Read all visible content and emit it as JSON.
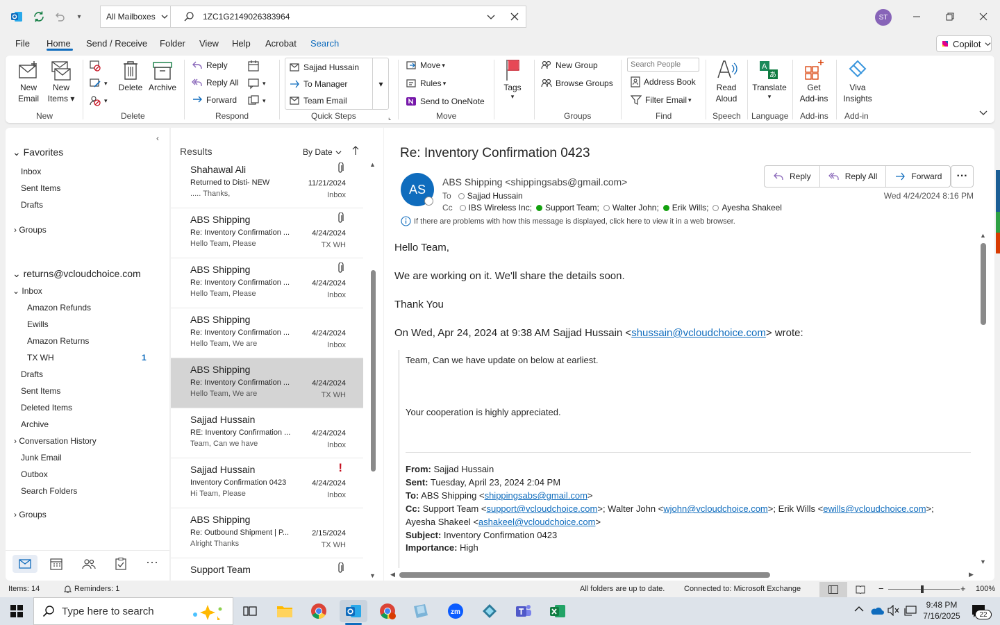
{
  "titlebar": {
    "mailbox_scope": "All Mailboxes",
    "search_value": "1ZC1G2149026383964",
    "user_initials": "ST"
  },
  "menu": {
    "items": [
      "File",
      "Home",
      "Send / Receive",
      "Folder",
      "View",
      "Help",
      "Acrobat",
      "Search"
    ],
    "active": "Home",
    "copilot": "Copilot"
  },
  "ribbon": {
    "new_email": [
      "New",
      "Email"
    ],
    "new_items": [
      "New",
      "Items"
    ],
    "delete": "Delete",
    "archive": "Archive",
    "reply": "Reply",
    "reply_all": "Reply All",
    "forward": "Forward",
    "quick_steps": [
      "Sajjad Hussain",
      "To Manager",
      "Team Email"
    ],
    "move": "Move",
    "rules": "Rules",
    "send_onenote": "Send to OneNote",
    "tags": "Tags",
    "new_group": "New Group",
    "browse_groups": "Browse Groups",
    "search_people_placeholder": "Search People",
    "address_book": "Address Book",
    "filter_email": "Filter Email",
    "read_aloud": [
      "Read",
      "Aloud"
    ],
    "translate": "Translate",
    "get_addins": [
      "Get",
      "Add-ins"
    ],
    "viva": [
      "Viva",
      "Insights"
    ],
    "groups": {
      "new": "New",
      "delete": "Delete",
      "respond": "Respond",
      "quick_steps": "Quick Steps",
      "move": "Move",
      "groups": "Groups",
      "find": "Find",
      "speech": "Speech",
      "language": "Language",
      "addins": "Add-ins",
      "addin": "Add-in"
    }
  },
  "nav": {
    "favorites": "Favorites",
    "fav_items": [
      "Inbox",
      "Sent Items",
      "Drafts"
    ],
    "groups": "Groups",
    "account": "returns@vcloudchoice.com",
    "inbox": "Inbox",
    "inbox_sub": [
      "Amazon Refunds",
      "Ewills",
      "Amazon Returns",
      "TX WH"
    ],
    "txwh_count": "1",
    "folders": [
      "Drafts",
      "Sent Items",
      "Deleted Items",
      "Archive",
      "Conversation History",
      "Junk Email",
      "Outbox",
      "Search Folders"
    ],
    "groups2": "Groups"
  },
  "list": {
    "header": "Results",
    "sort": "By Date",
    "messages": [
      {
        "from": "Shahawal Ali",
        "subject": "Returned to Disti- NEW",
        "preview": "..... Thanks,",
        "date": "11/21/2024",
        "folder": "Inbox"
      },
      {
        "from": "ABS Shipping",
        "subject": "Re: Inventory Confirmation ...",
        "preview": "Hello Team,  Please",
        "date": "4/24/2024",
        "folder": "TX WH"
      },
      {
        "from": "ABS Shipping",
        "subject": "Re: Inventory Confirmation ...",
        "preview": "Hello Team,  Please",
        "date": "4/24/2024",
        "folder": "Inbox"
      },
      {
        "from": "ABS Shipping",
        "subject": "Re: Inventory Confirmation ...",
        "preview": "Hello Team,  We are",
        "date": "4/24/2024",
        "folder": "Inbox"
      },
      {
        "from": "ABS Shipping",
        "subject": "Re: Inventory Confirmation ...",
        "preview": "Hello Team,  We are",
        "date": "4/24/2024",
        "folder": "TX WH"
      },
      {
        "from": "Sajjad Hussain",
        "subject": "RE: Inventory Confirmation ...",
        "preview": "Team, Can we have",
        "date": "4/24/2024",
        "folder": "Inbox"
      },
      {
        "from": "Sajjad Hussain",
        "subject": "Inventory Confirmation 0423",
        "preview": "Hi Team,  Please",
        "date": "4/24/2024",
        "folder": "Inbox"
      },
      {
        "from": "ABS Shipping",
        "subject": "Re: Outbound Shipment | P...",
        "preview": "Alright  Thanks",
        "date": "2/15/2024",
        "folder": "TX WH"
      },
      {
        "from": "Support Team",
        "subject": "",
        "preview": "",
        "date": "",
        "folder": ""
      }
    ]
  },
  "reading": {
    "subject": "Re: Inventory Confirmation 0423",
    "avatar": "AS",
    "sender": "ABS Shipping <shippingsabs@gmail.com>",
    "to_label": "To",
    "to": "Sajjad Hussain",
    "cc_label": "Cc",
    "cc": [
      "IBS Wireless Inc;",
      "Support Team;",
      "Walter John;",
      "Erik Wills;",
      "Ayesha Shakeel"
    ],
    "datetime": "Wed 4/24/2024 8:16 PM",
    "info": "If there are problems with how this message is displayed, click here to view it in a web browser.",
    "actions": [
      "Reply",
      "Reply All",
      "Forward"
    ],
    "body": {
      "greeting": "Hello Team,",
      "line1": "We are working on it. We'll share the details soon.",
      "thanks": "Thank You",
      "quote_intro": "On Wed, Apr 24, 2024 at 9:38 AM Sajjad Hussain <",
      "quote_email": "shussain@vcloudchoice.com",
      "quote_end": "> wrote:",
      "q1": "Team, Can we have update on below at earliest.",
      "q2": "Your cooperation is highly appreciated.",
      "from_label": "From:",
      "from": " Sajjad Hussain",
      "sent_label": "Sent:",
      "sent": " Tuesday, April 23, 2024 2:04 PM",
      "to_label": "To:",
      "to": " ABS Shipping <",
      "to_email": "shippingsabs@gmail.com",
      "cc_label": "Cc:",
      "cc1": " Support Team <",
      "cc_email1": "support@vcloudchoice.com",
      "cc2": ">; Walter John <",
      "cc_email2": "wjohn@vcloudchoice.com",
      "cc3": ">; Erik Wills <",
      "cc_email3": "ewills@vcloudchoice.com",
      "cc4": ">;",
      "cc5": "Ayesha Shakeel <",
      "cc_email4": "ashakeel@vcloudchoice.com",
      "subject_label": "Subject:",
      "subject": " Inventory Confirmation 0423",
      "importance_label": "Importance:",
      "importance": " High"
    }
  },
  "status": {
    "items": "Items: 14",
    "reminders": "Reminders: 1",
    "sync": "All folders are up to date.",
    "connection": "Connected to: Microsoft Exchange",
    "zoom": "100%"
  },
  "taskbar": {
    "search_placeholder": "Type here to search",
    "time": "9:48 PM",
    "date": "7/16/2025",
    "notif_count": "22"
  }
}
